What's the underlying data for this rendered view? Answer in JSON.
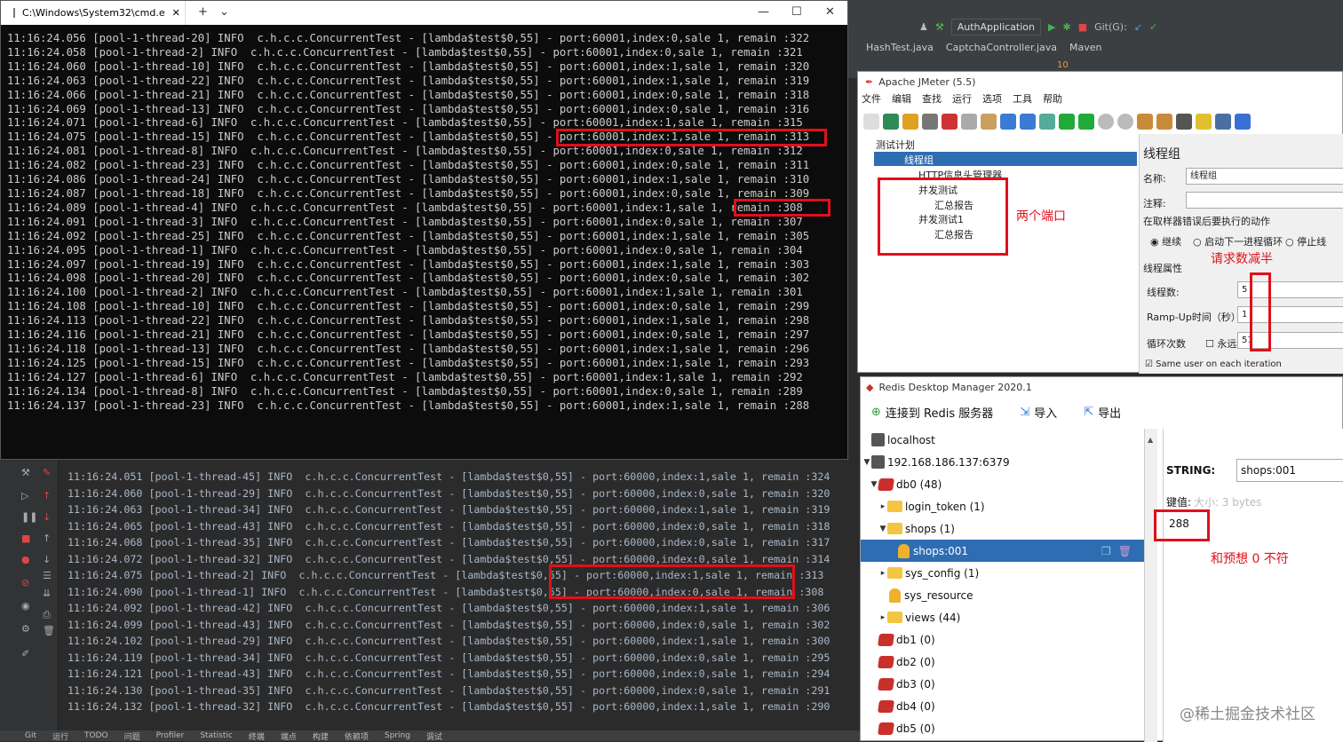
{
  "ide": {
    "run_config": "AuthApplication",
    "git_label": "Git(G):",
    "tabs": [
      "HashTest.java",
      "CaptchaController.java",
      "Maven"
    ],
    "problems_count": "10"
  },
  "cmd": {
    "title": "C:\\Windows\\System32\\cmd.e",
    "lines": [
      "11:16:24.056 [pool-1-thread-20] INFO  c.h.c.c.ConcurrentTest - [lambda$test$0,55] - port:60001,index:0,sale 1, remain :322",
      "11:16:24.058 [pool-1-thread-2] INFO  c.h.c.c.ConcurrentTest - [lambda$test$0,55] - port:60001,index:0,sale 1, remain :321",
      "11:16:24.060 [pool-1-thread-10] INFO  c.h.c.c.ConcurrentTest - [lambda$test$0,55] - port:60001,index:1,sale 1, remain :320",
      "11:16:24.063 [pool-1-thread-22] INFO  c.h.c.c.ConcurrentTest - [lambda$test$0,55] - port:60001,index:1,sale 1, remain :319",
      "11:16:24.066 [pool-1-thread-21] INFO  c.h.c.c.ConcurrentTest - [lambda$test$0,55] - port:60001,index:0,sale 1, remain :318",
      "11:16:24.069 [pool-1-thread-13] INFO  c.h.c.c.ConcurrentTest - [lambda$test$0,55] - port:60001,index:0,sale 1, remain :316",
      "11:16:24.071 [pool-1-thread-6] INFO  c.h.c.c.ConcurrentTest - [lambda$test$0,55] - port:60001,index:1,sale 1, remain :315",
      "11:16:24.075 [pool-1-thread-15] INFO  c.h.c.c.ConcurrentTest - [lambda$test$0,55] - port:60001,index:1,sale 1, remain :313",
      "11:16:24.081 [pool-1-thread-8] INFO  c.h.c.c.ConcurrentTest - [lambda$test$0,55] - port:60001,index:0,sale 1, remain :312",
      "11:16:24.082 [pool-1-thread-23] INFO  c.h.c.c.ConcurrentTest - [lambda$test$0,55] - port:60001,index:0,sale 1, remain :311",
      "11:16:24.086 [pool-1-thread-24] INFO  c.h.c.c.ConcurrentTest - [lambda$test$0,55] - port:60001,index:1,sale 1, remain :310",
      "11:16:24.087 [pool-1-thread-18] INFO  c.h.c.c.ConcurrentTest - [lambda$test$0,55] - port:60001,index:0,sale 1, remain :309",
      "11:16:24.089 [pool-1-thread-4] INFO  c.h.c.c.ConcurrentTest - [lambda$test$0,55] - port:60001,index:1,sale 1, remain :308",
      "11:16:24.091 [pool-1-thread-3] INFO  c.h.c.c.ConcurrentTest - [lambda$test$0,55] - port:60001,index:0,sale 1, remain :307",
      "11:16:24.092 [pool-1-thread-25] INFO  c.h.c.c.ConcurrentTest - [lambda$test$0,55] - port:60001,index:1,sale 1, remain :305",
      "11:16:24.095 [pool-1-thread-1] INFO  c.h.c.c.ConcurrentTest - [lambda$test$0,55] - port:60001,index:0,sale 1, remain :304",
      "11:16:24.097 [pool-1-thread-19] INFO  c.h.c.c.ConcurrentTest - [lambda$test$0,55] - port:60001,index:1,sale 1, remain :303",
      "11:16:24.098 [pool-1-thread-20] INFO  c.h.c.c.ConcurrentTest - [lambda$test$0,55] - port:60001,index:0,sale 1, remain :302",
      "11:16:24.100 [pool-1-thread-2] INFO  c.h.c.c.ConcurrentTest - [lambda$test$0,55] - port:60001,index:1,sale 1, remain :301",
      "11:16:24.108 [pool-1-thread-10] INFO  c.h.c.c.ConcurrentTest - [lambda$test$0,55] - port:60001,index:0,sale 1, remain :299",
      "11:16:24.113 [pool-1-thread-22] INFO  c.h.c.c.ConcurrentTest - [lambda$test$0,55] - port:60001,index:1,sale 1, remain :298",
      "11:16:24.116 [pool-1-thread-21] INFO  c.h.c.c.ConcurrentTest - [lambda$test$0,55] - port:60001,index:0,sale 1, remain :297",
      "11:16:24.118 [pool-1-thread-13] INFO  c.h.c.c.ConcurrentTest - [lambda$test$0,55] - port:60001,index:1,sale 1, remain :296",
      "11:16:24.125 [pool-1-thread-15] INFO  c.h.c.c.ConcurrentTest - [lambda$test$0,55] - port:60001,index:1,sale 1, remain :293",
      "11:16:24.127 [pool-1-thread-6] INFO  c.h.c.c.ConcurrentTest - [lambda$test$0,55] - port:60001,index:1,sale 1, remain :292",
      "11:16:24.134 [pool-1-thread-8] INFO  c.h.c.c.ConcurrentTest - [lambda$test$0,55] - port:60001,index:0,sale 1, remain :289",
      "11:16:24.137 [pool-1-thread-23] INFO  c.h.c.c.ConcurrentTest - [lambda$test$0,55] - port:60001,index:1,sale 1, remain :288"
    ]
  },
  "console": {
    "lines": [
      "11:16:24.051 [pool-1-thread-45] INFO  c.h.c.c.ConcurrentTest - [lambda$test$0,55] - port:60000,index:1,sale 1, remain :324",
      "11:16:24.060 [pool-1-thread-29] INFO  c.h.c.c.ConcurrentTest - [lambda$test$0,55] - port:60000,index:0,sale 1, remain :320",
      "11:16:24.063 [pool-1-thread-34] INFO  c.h.c.c.ConcurrentTest - [lambda$test$0,55] - port:60000,index:1,sale 1, remain :319",
      "11:16:24.065 [pool-1-thread-43] INFO  c.h.c.c.ConcurrentTest - [lambda$test$0,55] - port:60000,index:0,sale 1, remain :318",
      "11:16:24.068 [pool-1-thread-35] INFO  c.h.c.c.ConcurrentTest - [lambda$test$0,55] - port:60000,index:0,sale 1, remain :317",
      "11:16:24.072 [pool-1-thread-32] INFO  c.h.c.c.ConcurrentTest - [lambda$test$0,55] - port:60000,index:0,sale 1, remain :314",
      "11:16:24.075 [pool-1-thread-2] INFO  c.h.c.c.ConcurrentTest - [lambda$test$0,55] - port:60000,index:1,sale 1, remain :313",
      "11:16:24.090 [pool-1-thread-1] INFO  c.h.c.c.ConcurrentTest - [lambda$test$0,55] - port:60000,index:0,sale 1, remain :308",
      "11:16:24.092 [pool-1-thread-42] INFO  c.h.c.c.ConcurrentTest - [lambda$test$0,55] - port:60000,index:1,sale 1, remain :306",
      "11:16:24.099 [pool-1-thread-43] INFO  c.h.c.c.ConcurrentTest - [lambda$test$0,55] - port:60000,index:0,sale 1, remain :302",
      "11:16:24.102 [pool-1-thread-29] INFO  c.h.c.c.ConcurrentTest - [lambda$test$0,55] - port:60000,index:1,sale 1, remain :300",
      "11:16:24.119 [pool-1-thread-34] INFO  c.h.c.c.ConcurrentTest - [lambda$test$0,55] - port:60000,index:0,sale 1, remain :295",
      "11:16:24.121 [pool-1-thread-43] INFO  c.h.c.c.ConcurrentTest - [lambda$test$0,55] - port:60000,index:0,sale 1, remain :294",
      "11:16:24.130 [pool-1-thread-35] INFO  c.h.c.c.ConcurrentTest - [lambda$test$0,55] - port:60000,index:0,sale 1, remain :291",
      "11:16:24.132 [pool-1-thread-32] INFO  c.h.c.c.ConcurrentTest - [lambda$test$0,55] - port:60000,index:1,sale 1, remain :290"
    ]
  },
  "status_bar": [
    "Git",
    "运行",
    "TODO",
    "问题",
    "Profiler",
    "Statistic",
    "终端",
    "端点",
    "构建",
    "依赖项",
    "Spring",
    "调试"
  ],
  "jmeter": {
    "title": "Apache JMeter (5.5)",
    "menu": [
      "文件",
      "编辑",
      "查找",
      "运行",
      "选项",
      "工具",
      "帮助"
    ],
    "tree": {
      "test_plan": "测试计划",
      "thread_group": "线程组",
      "header_manager": "HTTP信息头管理器",
      "sampler1": "并发测试",
      "report1": "汇总报告",
      "sampler2": "并发测试1",
      "report2": "汇总报告"
    },
    "annotation_ports": "两个端口",
    "panel_title": "线程组",
    "name_label": "名称:",
    "name_value": "线程组",
    "comment_label": "注释:",
    "error_action_label": "在取样器错误后要执行的动作",
    "opt_continue": "继续",
    "opt_next_loop": "启动下一进程循环",
    "opt_stop": "停止线",
    "thread_props": "线程属性",
    "annotation_half": "请求数减半",
    "threads_label": "线程数:",
    "threads_value": "5",
    "ramp_label": "Ramp-Up时间（秒）:",
    "ramp_value": "1",
    "loop_label": "循环次数",
    "forever_label": "永远",
    "loop_value": "51",
    "same_user": "Same user on each iteration"
  },
  "rdm": {
    "title": "Redis Desktop Manager 2020.1",
    "connect": "连接到 Redis 服务器",
    "import": "导入",
    "export": "导出",
    "tree": [
      {
        "label": "localhost"
      },
      {
        "label": "192.168.186.137:6379"
      },
      {
        "label": "db0  (48)"
      },
      {
        "label": "login_token (1)"
      },
      {
        "label": "shops (1)"
      },
      {
        "label": "shops:001"
      },
      {
        "label": "sys_config (1)"
      },
      {
        "label": "sys_resource"
      },
      {
        "label": "views (44)"
      },
      {
        "label": "db1   (0)"
      },
      {
        "label": "db2   (0)"
      },
      {
        "label": "db3   (0)"
      },
      {
        "label": "db4   (0)"
      },
      {
        "label": "db5   (0)"
      }
    ],
    "type_label": "STRING:",
    "key_name": "shops:001",
    "value_label": "键值:",
    "size_hint": "大小: 3 bytes",
    "value": "288",
    "annotation_expect": "和预想 0 不符"
  },
  "watermark": "@稀土掘金技术社区",
  "colors": {
    "highlight": "#e0101a",
    "selection": "#2f6db3"
  }
}
